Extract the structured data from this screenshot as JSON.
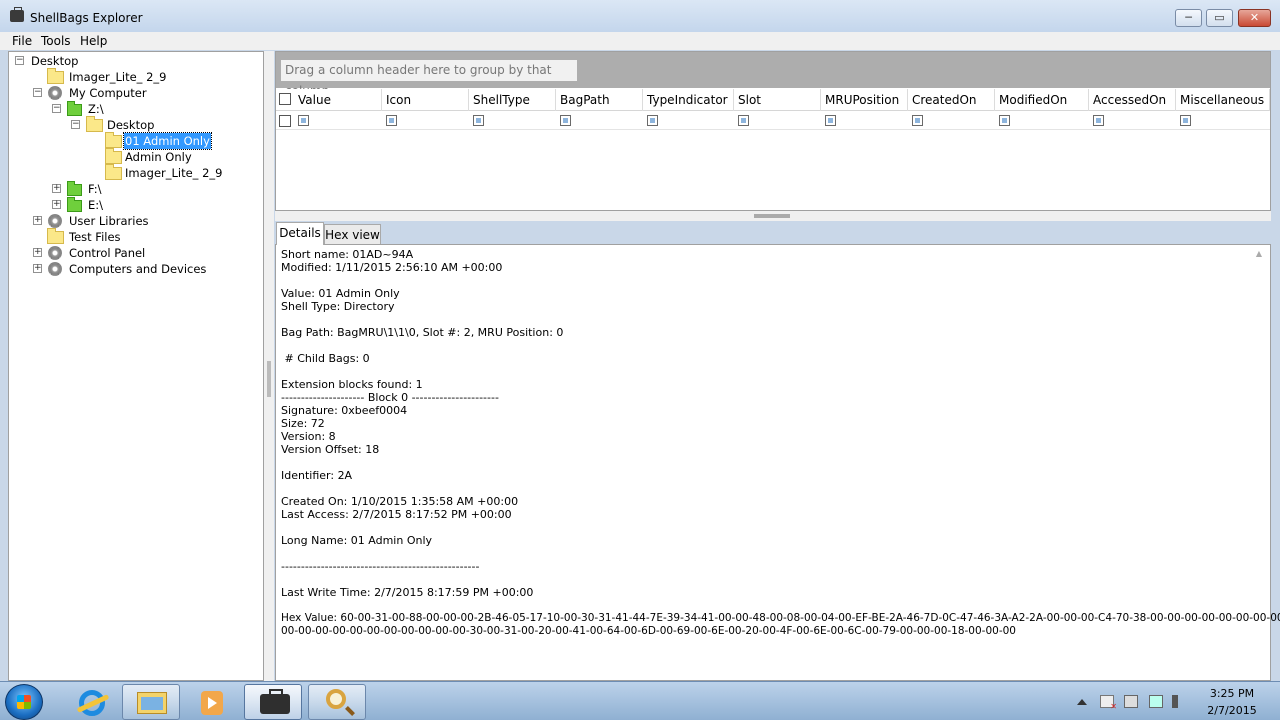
{
  "window": {
    "title": "ShellBags Explorer",
    "minimize": "─",
    "maximize": "▭",
    "close": "✕"
  },
  "menu": [
    "File",
    "Tools",
    "Help"
  ],
  "tree": [
    {
      "label": "Desktop"
    },
    {
      "label": "Imager_Lite_ 2_9"
    },
    {
      "label": "My Computer"
    },
    {
      "label": "Z:\\"
    },
    {
      "label": "Desktop"
    },
    {
      "label": "01 Admin Only"
    },
    {
      "label": "Admin Only"
    },
    {
      "label": "Imager_Lite_ 2_9"
    },
    {
      "label": "F:\\"
    },
    {
      "label": "E:\\"
    },
    {
      "label": "User Libraries"
    },
    {
      "label": "Test Files"
    },
    {
      "label": "Control Panel"
    },
    {
      "label": "Computers and Devices"
    }
  ],
  "grid": {
    "group_hint": "Drag a column header here to group by that column.",
    "columns": [
      "Value",
      "Icon",
      "ShellType",
      "BagPath",
      "TypeIndicator",
      "Slot",
      "MRUPosition",
      "CreatedOn",
      "ModifiedOn",
      "AccessedOn",
      "Miscellaneous"
    ]
  },
  "tabs": {
    "details": "Details",
    "hex": "Hex view"
  },
  "details": [
    "Short name: 01AD~94A",
    "Modified: 1/11/2015 2:56:10 AM +00:00",
    "",
    "Value: 01 Admin Only",
    "Shell Type: Directory",
    "",
    "Bag Path: BagMRU\\1\\1\\0, Slot #: 2, MRU Position: 0",
    "",
    " # Child Bags: 0",
    "",
    "Extension blocks found: 1",
    "--------------------- Block 0 ----------------------",
    "Signature: 0xbeef0004",
    "Size: 72",
    "Version: 8",
    "Version Offset: 18",
    "",
    "Identifier: 2A",
    "",
    "Created On: 1/10/2015 1:35:58 AM +00:00",
    "Last Access: 2/7/2015 8:17:52 PM +00:00",
    "",
    "Long Name: 01 Admin Only",
    "",
    "--------------------------------------------------",
    "",
    "Last Write Time: 2/7/2015 8:17:59 PM +00:00",
    "",
    "Hex Value: 60-00-31-00-88-00-00-00-2B-46-05-17-10-00-30-31-41-44-7E-39-34-41-00-00-48-00-08-00-04-00-EF-BE-2A-46-7D-0C-47-46-3A-A2-2A-00-00-00-C4-70-38-00-00-00-00-00-00-00-00-00-",
    "00-00-00-00-00-00-00-00-00-00-00-30-00-31-00-20-00-41-00-64-00-6D-00-69-00-6E-00-20-00-4F-00-6E-00-6C-00-79-00-00-00-18-00-00-00"
  ],
  "taskbar": {
    "time": "3:25 PM",
    "date": "2/7/2015"
  }
}
